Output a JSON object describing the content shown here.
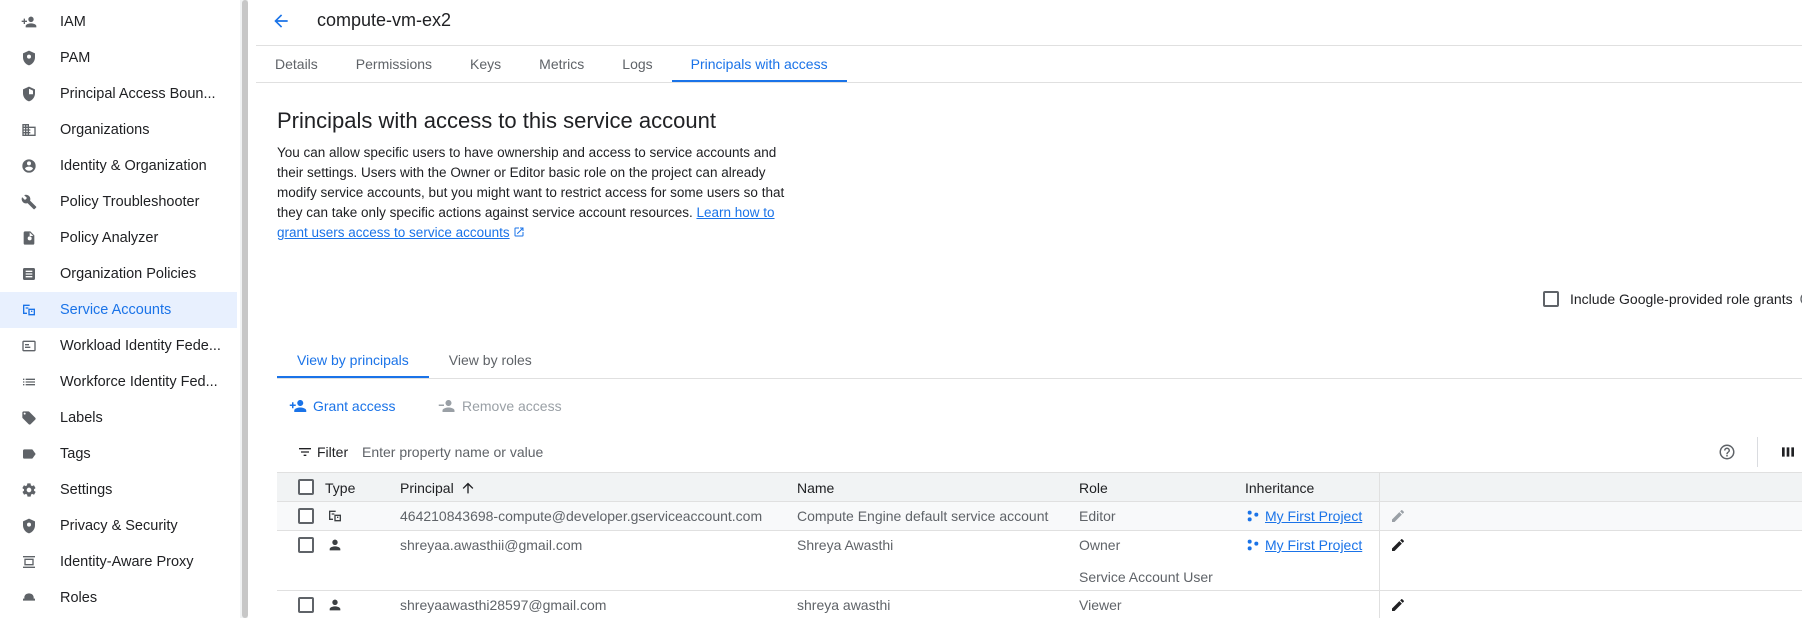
{
  "sidebar": {
    "items": [
      {
        "label": "IAM",
        "icon": "person-add-icon"
      },
      {
        "label": "PAM",
        "icon": "shield-icon"
      },
      {
        "label": "Principal Access Boun...",
        "icon": "shield-gear-icon"
      },
      {
        "label": "Organizations",
        "icon": "building-icon"
      },
      {
        "label": "Identity & Organization",
        "icon": "account-circle-icon"
      },
      {
        "label": "Policy Troubleshooter",
        "icon": "wrench-icon"
      },
      {
        "label": "Policy Analyzer",
        "icon": "document-search-icon"
      },
      {
        "label": "Organization Policies",
        "icon": "list-box-icon"
      },
      {
        "label": "Service Accounts",
        "icon": "service-account-icon",
        "active": true
      },
      {
        "label": "Workload Identity Fede...",
        "icon": "id-card-icon"
      },
      {
        "label": "Workforce Identity Fed...",
        "icon": "list-icon"
      },
      {
        "label": "Labels",
        "icon": "label-icon"
      },
      {
        "label": "Tags",
        "icon": "tag-icon"
      },
      {
        "label": "Settings",
        "icon": "gear-icon"
      },
      {
        "label": "Privacy & Security",
        "icon": "shield-icon"
      },
      {
        "label": "Identity-Aware Proxy",
        "icon": "proxy-icon"
      },
      {
        "label": "Roles",
        "icon": "hat-icon"
      }
    ]
  },
  "header": {
    "title": "compute-vm-ex2"
  },
  "tabs": [
    {
      "label": "Details"
    },
    {
      "label": "Permissions"
    },
    {
      "label": "Keys"
    },
    {
      "label": "Metrics"
    },
    {
      "label": "Logs"
    },
    {
      "label": "Principals with access",
      "active": true
    }
  ],
  "section": {
    "title": "Principals with access to this service account",
    "description": "You can allow specific users to have ownership and access to service accounts and their settings. Users with the Owner or Editor basic role on the project can already modify service accounts, but you might want to restrict access for some users so that they can take only specific actions against service account resources.",
    "link_text": "Learn how to grant users access to service accounts"
  },
  "include_google": {
    "label": "Include Google-provided role grants",
    "checked": false
  },
  "subtabs": [
    {
      "label": "View by principals",
      "active": true
    },
    {
      "label": "View by roles"
    }
  ],
  "actions": {
    "grant": "Grant access",
    "remove": "Remove access"
  },
  "filter": {
    "label": "Filter",
    "placeholder": "Enter property name or value"
  },
  "table": {
    "columns": {
      "type": "Type",
      "principal": "Principal",
      "name": "Name",
      "role": "Role",
      "inheritance": "Inheritance"
    },
    "rows": [
      {
        "type_icon": "service-account-icon",
        "principal": "464210843698-compute@developer.gserviceaccount.com",
        "name": "Compute Engine default service account",
        "roles": [
          "Editor"
        ],
        "inheritance": "My First Project"
      },
      {
        "type_icon": "person-icon",
        "principal": "shreyaa.awasthii@gmail.com",
        "name": "Shreya Awasthi",
        "roles": [
          "Owner",
          "Service Account User"
        ],
        "inheritance": "My First Project"
      },
      {
        "type_icon": "person-icon",
        "principal": "shreyaawasthi28597@gmail.com",
        "name": "shreya awasthi",
        "roles": [
          "Viewer"
        ],
        "inheritance": ""
      }
    ]
  },
  "colors": {
    "accent": "#1a73e8",
    "active_bg": "#e8f0fe",
    "text": "#202124",
    "muted": "#5f6368"
  }
}
